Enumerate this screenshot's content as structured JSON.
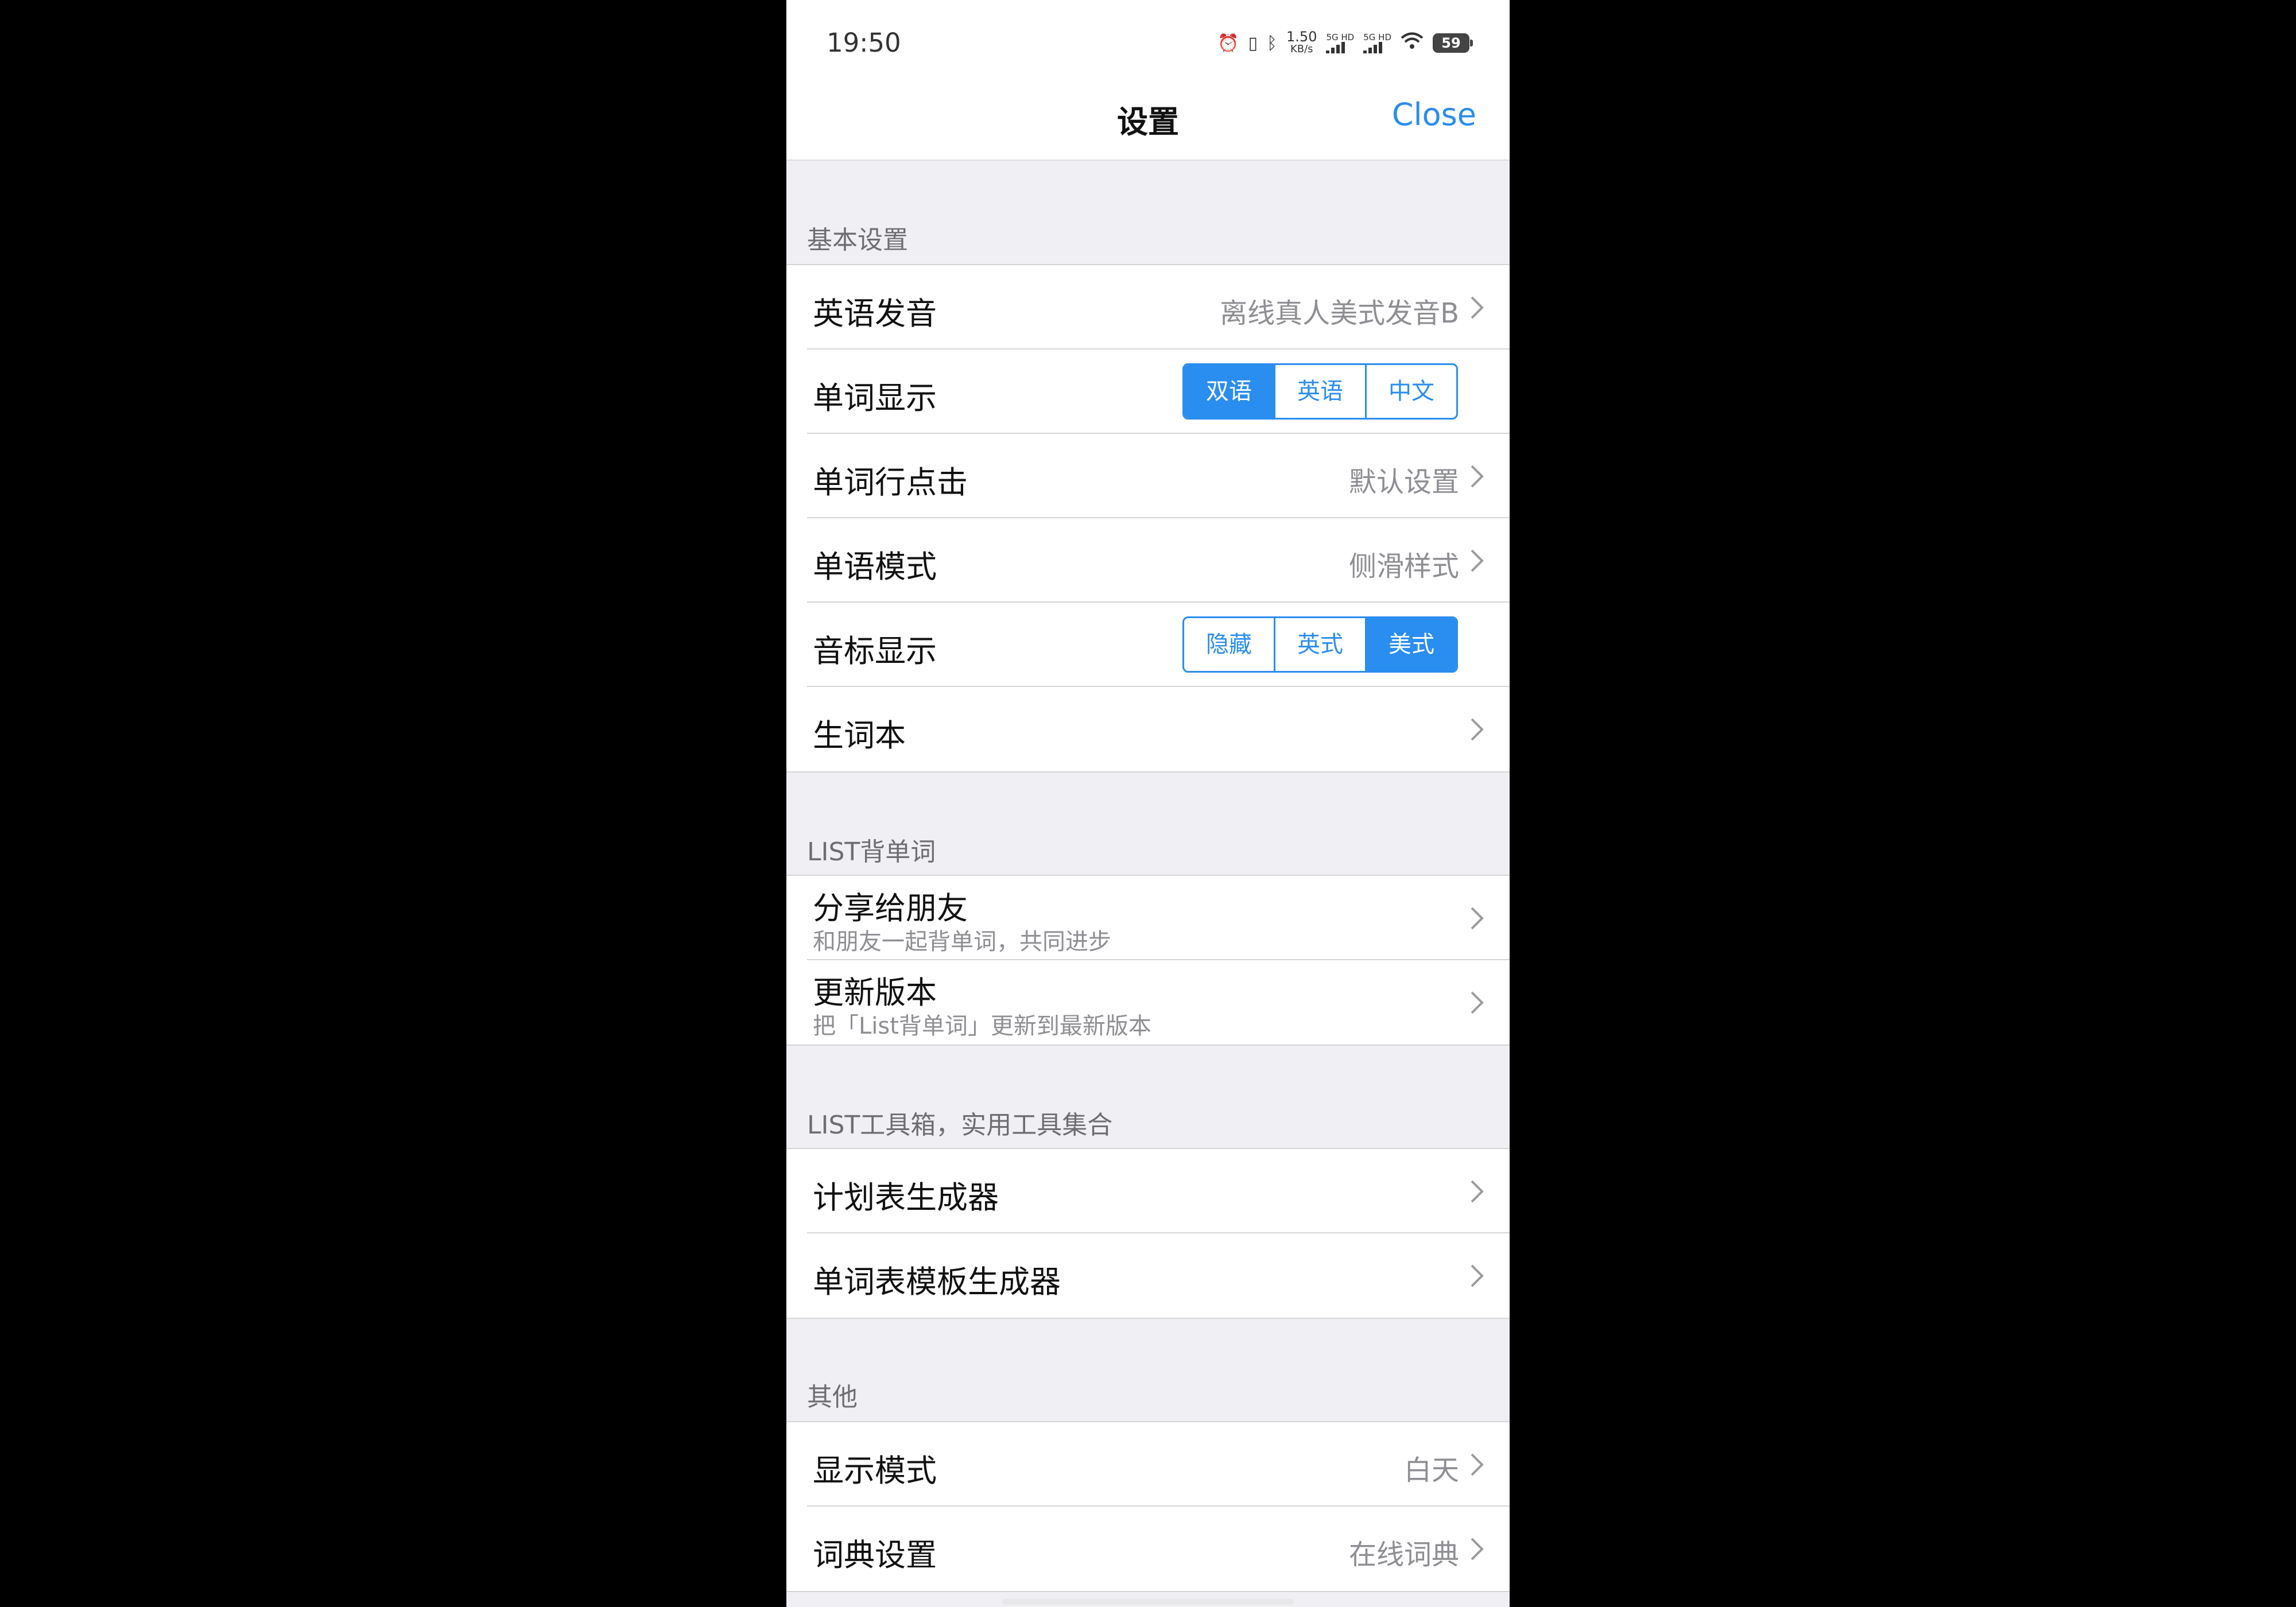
{
  "status": {
    "time": "19:50",
    "speed_value": "1.50",
    "speed_unit": "KB/s",
    "sim1": "5G HD",
    "sim2": "5G HD",
    "battery": "59"
  },
  "nav": {
    "title": "设置",
    "close": "Close"
  },
  "sections": {
    "basic": {
      "header": "基本设置",
      "pronunciation": {
        "label": "英语发音",
        "value": "离线真人美式发音B"
      },
      "word_display": {
        "label": "单词显示",
        "options": [
          "双语",
          "英语",
          "中文"
        ],
        "selected": 0
      },
      "row_click": {
        "label": "单词行点击",
        "value": "默认设置"
      },
      "word_mode": {
        "label": "单语模式",
        "value": "侧滑样式"
      },
      "phonetic": {
        "label": "音标显示",
        "options": [
          "隐藏",
          "英式",
          "美式"
        ],
        "selected": 2
      },
      "vocab_book": {
        "label": "生词本"
      }
    },
    "list": {
      "header": "LIST背单词",
      "share": {
        "label": "分享给朋友",
        "sub": "和朋友一起背单词，共同进步"
      },
      "update": {
        "label": "更新版本",
        "sub": "把「List背单词」更新到最新版本"
      }
    },
    "tools": {
      "header": "LIST工具箱，实用工具集合",
      "plan": {
        "label": "计划表生成器"
      },
      "template": {
        "label": "单词表模板生成器"
      }
    },
    "other": {
      "header": "其他",
      "display_mode": {
        "label": "显示模式",
        "value": "白天"
      },
      "dict": {
        "label": "词典设置",
        "value": "在线词典"
      }
    }
  }
}
